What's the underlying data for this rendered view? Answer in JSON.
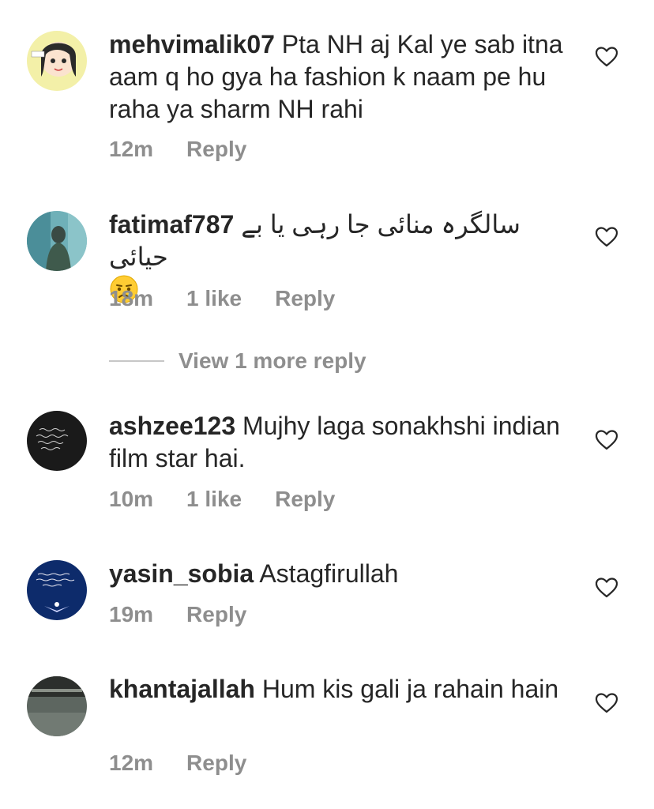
{
  "comments": [
    {
      "username": "mehvimalik07",
      "text": "Pta NH aj Kal ye sab itna aam q ho gya ha fashion k naam pe hu raha ya sharm NH rahi",
      "time": "12m",
      "likes": "",
      "reply_label": "Reply",
      "avatar": "cartoon-girl-avatar"
    },
    {
      "username": "fatimaf787",
      "text": "سالگرہ منائی جا رہی یا بے حیائی",
      "time": "18m",
      "likes": "1 like",
      "reply_label": "Reply",
      "avatar": "photo-avatar",
      "emoji": "crying-face-emoji"
    },
    {
      "username": "ashzee123",
      "text": "Mujhy laga sonakhshi indian film star hai.",
      "time": "10m",
      "likes": "1 like",
      "reply_label": "Reply",
      "avatar": "quote-image-avatar"
    },
    {
      "username": "yasin_sobia",
      "text": "Astagfirullah",
      "time": "19m",
      "likes": "",
      "reply_label": "Reply",
      "avatar": "quote-image-avatar"
    },
    {
      "username": "khantajallah",
      "text": "Hum kis gali ja rahain hain",
      "time": "12m",
      "likes": "",
      "reply_label": "Reply",
      "avatar": "photo-avatar"
    }
  ],
  "view_more_replies": "View 1 more reply",
  "colors": {
    "text": "#262626",
    "meta": "#8e8e8e",
    "divider": "#c7c7c7"
  }
}
